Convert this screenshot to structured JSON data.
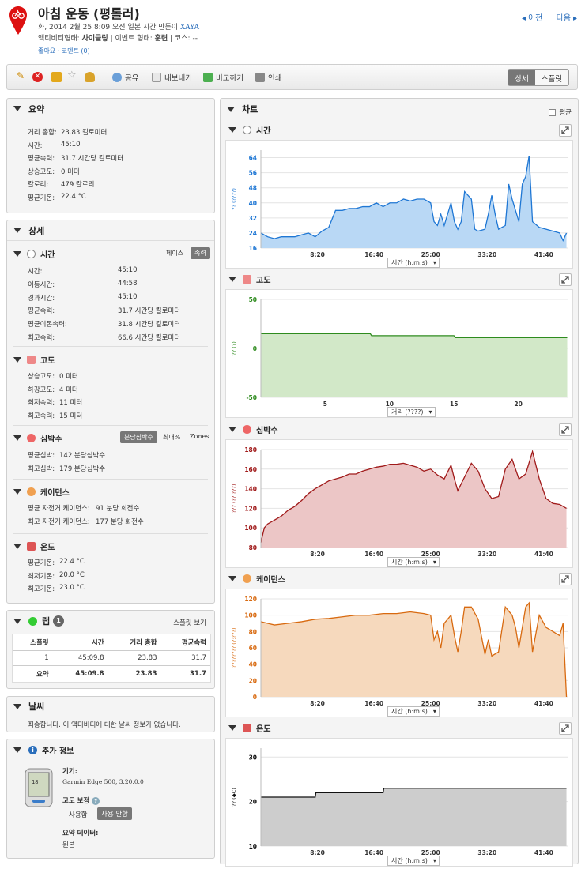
{
  "header": {
    "title": "아침 운동 (평롤러)",
    "meta1_prefix": "화, 2014 2월 25 8:09 오전 일본 시간 만든이",
    "owner": "XAYA",
    "meta2_a": "액티비티형태:",
    "activity_type": "사이클링",
    "meta2_b": "| 이벤트 형태:",
    "event_type": "훈련",
    "meta2_c": "| 코스:",
    "course": "--",
    "like": "좋아요",
    "comment": "코멘트 (0)",
    "prev": "이전",
    "next": "다음"
  },
  "toolbar": {
    "share": "공유",
    "export": "내보내기",
    "compare": "비교하기",
    "print": "인쇄",
    "detail": "상세",
    "splits": "스플릿"
  },
  "summary": {
    "title": "요약",
    "rows": [
      {
        "label": "거리 총합:",
        "value": "23.83 킬로미터"
      },
      {
        "label": "시간:",
        "value": "45:10"
      },
      {
        "label": "평균속력:",
        "value": "31.7 시간당 킬로미터"
      },
      {
        "label": "상승고도:",
        "value": "0 미터"
      },
      {
        "label": "칼로리:",
        "value": "479 칼로리"
      },
      {
        "label": "평균기온:",
        "value": "22.4 °C"
      }
    ]
  },
  "details": {
    "title": "상세",
    "time": {
      "title": "시간",
      "pace": "페이스",
      "speed": "속력",
      "rows": [
        {
          "label": "시간:",
          "value": "45:10"
        },
        {
          "label": "이동시간:",
          "value": "44:58"
        },
        {
          "label": "경과시간:",
          "value": "45:10"
        },
        {
          "label": "평균속력:",
          "value": "31.7 시간당 킬로미터"
        },
        {
          "label": "평균이동속력:",
          "value": "31.8 시간당 킬로미터"
        },
        {
          "label": "최고속력:",
          "value": "66.6 시간당 킬로미터"
        }
      ]
    },
    "elevation": {
      "title": "고도",
      "rows": [
        {
          "label": "상승고도:",
          "value": "0 미터"
        },
        {
          "label": "하강고도:",
          "value": "4 미터"
        },
        {
          "label": "최저속력:",
          "value": "11 미터"
        },
        {
          "label": "최고속력:",
          "value": "15 미터"
        }
      ]
    },
    "hr": {
      "title": "심박수",
      "bpm": "분당심박수",
      "max": "최대%",
      "zones": "Zones",
      "rows": [
        {
          "label": "평균심박:",
          "value": "142 분당심박수"
        },
        {
          "label": "최고심박:",
          "value": "179 분당심박수"
        }
      ]
    },
    "cadence": {
      "title": "케이던스",
      "rows": [
        {
          "label": "평균 자전거 케이던스:",
          "value": "91 분당 회전수"
        },
        {
          "label": "최고 자전거 케이던스:",
          "value": "177 분당 회전수"
        }
      ]
    },
    "temp": {
      "title": "온도",
      "rows": [
        {
          "label": "평균기온:",
          "value": "22.4 °C"
        },
        {
          "label": "최저기온:",
          "value": "20.0 °C"
        },
        {
          "label": "최고기온:",
          "value": "23.0 °C"
        }
      ]
    }
  },
  "laps": {
    "title": "랩",
    "count": "1",
    "split_view": "스플릿 보기",
    "headers": [
      "스플릿",
      "시간",
      "거리 총합",
      "평균속력"
    ],
    "rows": [
      [
        "1",
        "45:09.8",
        "23.83",
        "31.7"
      ]
    ],
    "total": [
      "요약",
      "45:09.8",
      "23.83",
      "31.7"
    ]
  },
  "weather": {
    "title": "날씨",
    "text": "죄송합니다. 이 액티비티에 대한 날씨 정보가 없습니다."
  },
  "extra": {
    "title": "추가 정보",
    "device_label": "기기:",
    "device": "Garmin Edge 500, 3.20.0.0",
    "elev_corr": "고도 보정",
    "use": "사용함",
    "nouse": "사용 안함",
    "summary_data": "요약 데이터:",
    "original": "원본"
  },
  "charts": {
    "title": "차트",
    "avg": "평균"
  },
  "colors": {
    "time": "#1f77d4",
    "elev": "#2e8b1e",
    "hr": "#a01a1a",
    "cad": "#d86a10",
    "temp": "#111111"
  },
  "chart_data": [
    {
      "type": "area",
      "title": "시간",
      "ylabel": "?? (????)",
      "xselect": "시간 (h:m:s)",
      "x_ticks": [
        "8:20",
        "16:40",
        "25:00",
        "33:20",
        "41:40"
      ],
      "x_tick_min": [
        8.333,
        16.667,
        25,
        33.333,
        41.667
      ],
      "xlim": [
        0,
        45.17
      ],
      "ylim": [
        16,
        68
      ],
      "y_ticks": [
        16,
        24,
        32,
        40,
        48,
        56,
        64
      ],
      "x": [
        0,
        1,
        2,
        3,
        5,
        6,
        7,
        8,
        9,
        10,
        11,
        12,
        13,
        14,
        15,
        16,
        17,
        18,
        19,
        20,
        21,
        22,
        23,
        24,
        25,
        25.5,
        26,
        26.5,
        27,
        28,
        28.5,
        29,
        29.5,
        30,
        31,
        31.5,
        32,
        33,
        33.5,
        34,
        34.5,
        35,
        36,
        36.5,
        37,
        38,
        38.5,
        39,
        39.5,
        40,
        41,
        42,
        43,
        44,
        44.5,
        45
      ],
      "values": [
        24,
        22,
        21,
        22,
        22,
        23,
        24,
        22,
        25,
        27,
        36,
        36,
        37,
        37,
        38,
        38,
        40,
        38,
        40,
        40,
        42,
        41,
        42,
        42,
        40,
        30,
        28,
        34,
        28,
        40,
        30,
        26,
        30,
        46,
        42,
        26,
        25,
        26,
        34,
        44,
        34,
        26,
        28,
        50,
        42,
        30,
        50,
        54,
        65,
        30,
        27,
        26,
        25,
        24,
        20,
        24
      ]
    },
    {
      "type": "area",
      "title": "고도",
      "ylabel": "?? (?)",
      "xselect": "거리 (????)",
      "x_ticks": [
        "5",
        "10",
        "15",
        "20"
      ],
      "xlim": [
        0,
        23.83
      ],
      "ylim": [
        -50,
        50
      ],
      "y_ticks": [
        -50,
        0,
        50
      ],
      "x": [
        0,
        8.5,
        8.6,
        15,
        15.1,
        23.8
      ],
      "values": [
        15,
        15,
        13,
        13,
        11,
        11
      ]
    },
    {
      "type": "area",
      "title": "심박수",
      "ylabel": "??? (?? ???)",
      "xselect": "시간 (h:m:s)",
      "x_ticks": [
        "8:20",
        "16:40",
        "25:00",
        "33:20",
        "41:40"
      ],
      "x_tick_min": [
        8.333,
        16.667,
        25,
        33.333,
        41.667
      ],
      "xlim": [
        0,
        45.17
      ],
      "ylim": [
        80,
        180
      ],
      "y_ticks": [
        80,
        100,
        120,
        140,
        160,
        180
      ],
      "x": [
        0,
        0.5,
        1,
        2,
        3,
        4,
        5,
        6,
        7,
        8,
        9,
        10,
        11,
        12,
        13,
        14,
        15,
        16,
        17,
        18,
        19,
        20,
        21,
        22,
        23,
        24,
        25,
        26,
        27,
        28,
        28.5,
        29,
        30,
        31,
        32,
        33,
        34,
        35,
        36,
        37,
        38,
        39,
        40,
        41,
        42,
        43,
        44,
        45
      ],
      "values": [
        85,
        100,
        104,
        108,
        112,
        118,
        122,
        128,
        135,
        140,
        144,
        148,
        150,
        152,
        155,
        155,
        158,
        160,
        162,
        163,
        165,
        165,
        166,
        164,
        162,
        158,
        160,
        154,
        150,
        164,
        150,
        138,
        152,
        166,
        158,
        140,
        130,
        132,
        160,
        170,
        150,
        155,
        178,
        150,
        130,
        125,
        124,
        120
      ]
    },
    {
      "type": "area",
      "title": "케이던스",
      "ylabel": "???????? (?:???)",
      "xselect": "시간 (h:m:s)",
      "x_ticks": [
        "8:20",
        "16:40",
        "25:00",
        "33:20",
        "41:40"
      ],
      "x_tick_min": [
        8.333,
        16.667,
        25,
        33.333,
        41.667
      ],
      "xlim": [
        0,
        45.17
      ],
      "ylim": [
        0,
        120
      ],
      "y_ticks": [
        0,
        20,
        40,
        60,
        80,
        100,
        120
      ],
      "x": [
        0,
        1,
        2,
        4,
        6,
        8,
        10,
        12,
        14,
        16,
        18,
        20,
        22,
        24,
        25,
        25.5,
        26,
        26.5,
        27,
        28,
        28.5,
        29,
        29.5,
        30,
        31,
        32,
        33,
        33.5,
        34,
        35,
        36,
        37,
        37.5,
        38,
        39,
        39.5,
        40,
        41,
        42,
        43,
        44,
        44.5,
        45
      ],
      "values": [
        92,
        90,
        88,
        90,
        92,
        95,
        96,
        98,
        100,
        100,
        102,
        102,
        104,
        102,
        100,
        70,
        80,
        60,
        90,
        100,
        75,
        55,
        80,
        110,
        110,
        95,
        52,
        70,
        50,
        55,
        110,
        100,
        85,
        60,
        110,
        115,
        55,
        100,
        85,
        80,
        75,
        90,
        0
      ]
    },
    {
      "type": "area",
      "title": "온도",
      "ylabel": "?? (◆C)",
      "xselect": "시간 (h:m:s)",
      "x_ticks": [
        "8:20",
        "16:40",
        "25:00",
        "33:20",
        "41:40"
      ],
      "x_tick_min": [
        8.333,
        16.667,
        25,
        33.333,
        41.667
      ],
      "xlim": [
        0,
        45.17
      ],
      "ylim": [
        10,
        32
      ],
      "y_ticks": [
        10,
        20,
        30
      ],
      "x": [
        0,
        8,
        8.1,
        18,
        18.1,
        45
      ],
      "values": [
        21,
        21,
        22,
        22,
        23,
        23
      ]
    }
  ]
}
